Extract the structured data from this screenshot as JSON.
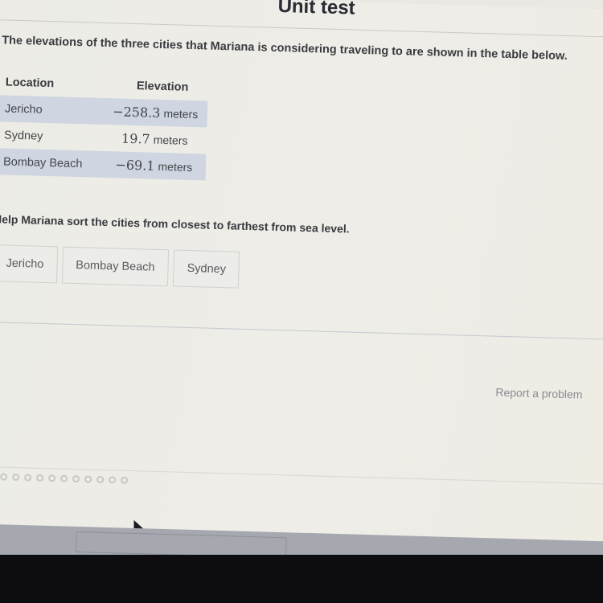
{
  "page": {
    "title": "Unit test"
  },
  "question": {
    "prompt": "The elevations of the three cities that Mariana is considering traveling to are shown in the table below.",
    "table": {
      "headers": [
        "Location",
        "Elevation"
      ],
      "rows": [
        {
          "location": "Jericho",
          "value": "−258.3",
          "unit": "meters"
        },
        {
          "location": "Sydney",
          "value": "19.7",
          "unit": "meters"
        },
        {
          "location": "Bombay Beach",
          "value": "−69.1",
          "unit": "meters"
        }
      ]
    },
    "instruction": "Help Mariana sort the cities from closest to farthest from sea level.",
    "sortable_tiles": [
      "Jericho",
      "Bombay Beach",
      "Sydney"
    ]
  },
  "footer": {
    "report_link": "Report a problem",
    "progress_dots_count": 12
  }
}
